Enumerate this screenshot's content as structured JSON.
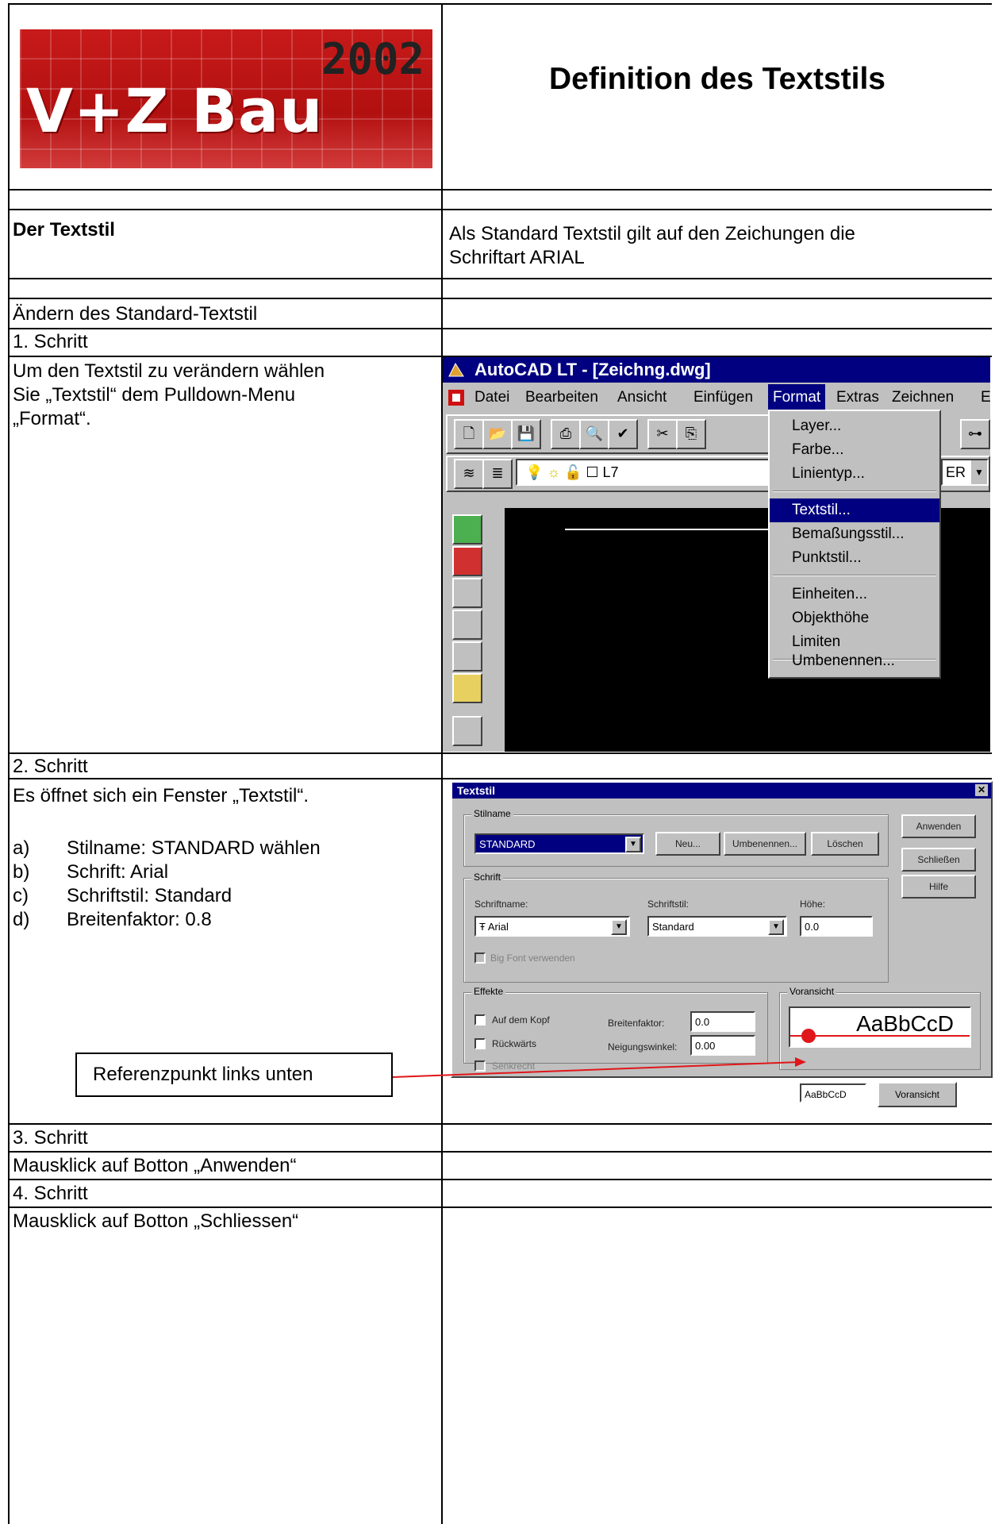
{
  "header": {
    "logo": {
      "year": "2002",
      "brand": "V+Z Bau"
    },
    "title": "Definition des Textstils"
  },
  "rows": {
    "textstil_label": "Der Textstil",
    "textstil_desc": "Als Standard Textstil gilt auf den Zeichungen die\nSchriftart ARIAL",
    "section_heading": "Ändern des Standard-Textstil",
    "step1_title": "1. Schritt",
    "step1_text": "Um den Textstil zu verändern wählen\nSie „Textstil“ dem Pulldown-Menu\n„Format“.",
    "step2_title": "2. Schritt",
    "step2_intro": "Es öffnet sich ein Fenster „Textstil“.",
    "step2_items": [
      {
        "key": "a)",
        "text": "Stilname: STANDARD wählen"
      },
      {
        "key": "b)",
        "text": "Schrift: Arial"
      },
      {
        "key": "c)",
        "text": "Schriftstil: Standard"
      },
      {
        "key": "d)",
        "text": "Breitenfaktor: 0.8"
      }
    ],
    "callout": "Referenzpunkt links unten",
    "step3_title": "3. Schritt",
    "step3_text": "Mausklick auf Botton „Anwenden“",
    "step4_title": "4. Schritt",
    "step4_text": "Mausklick auf Botton „Schliessen“"
  },
  "autocad": {
    "window_title": "AutoCAD LT - [Zeichng.dwg]",
    "menubar": [
      "Datei",
      "Bearbeiten",
      "Ansicht",
      "Einfügen",
      "Format",
      "Extras",
      "Zeichnen",
      "E"
    ],
    "active_menu": "Format",
    "layer_name": "L7",
    "layer_right": "ER",
    "format_menu": [
      "Layer...",
      "Farbe...",
      "Linientyp...",
      "Textstil...",
      "Bemaßungsstil...",
      "Punktstil...",
      "Einheiten...",
      "Objekthöhe",
      "Limiten",
      "Umbenennen..."
    ],
    "selected_item": "Textstil..."
  },
  "dialog": {
    "title": "Textstil",
    "group_stilname": "Stilname",
    "stilname_value": "STANDARD",
    "btn_neu": "Neu...",
    "btn_umbenennen": "Umbenennen...",
    "btn_loeschen": "Löschen",
    "btn_anwenden": "Anwenden",
    "btn_schliessen": "Schließen",
    "btn_hilfe": "Hilfe",
    "group_schrift": "Schrift",
    "lbl_schriftname": "Schriftname:",
    "schriftname_value": "Arial",
    "lbl_schriftstil": "Schriftstil:",
    "schriftstil_value": "Standard",
    "lbl_hoehe": "Höhe:",
    "hoehe_value": "0.0",
    "chk_bigfont": "Big Font verwenden",
    "group_effekte": "Effekte",
    "chk_kopf": "Auf dem Kopf",
    "chk_rueck": "Rückwärts",
    "chk_senk": "Senkrecht",
    "lbl_breite": "Breitenfaktor:",
    "breite_value": "0.0",
    "lbl_neigung": "Neigungswinkel:",
    "neigung_value": "0.00",
    "group_vorschau": "Voransicht",
    "preview_text": "AaBbCcD",
    "preview_input": "AaBbCcD",
    "btn_vorschau": "Voransicht"
  },
  "colors": {
    "accent_red": "#e0161a",
    "title_blue": "#000080"
  }
}
